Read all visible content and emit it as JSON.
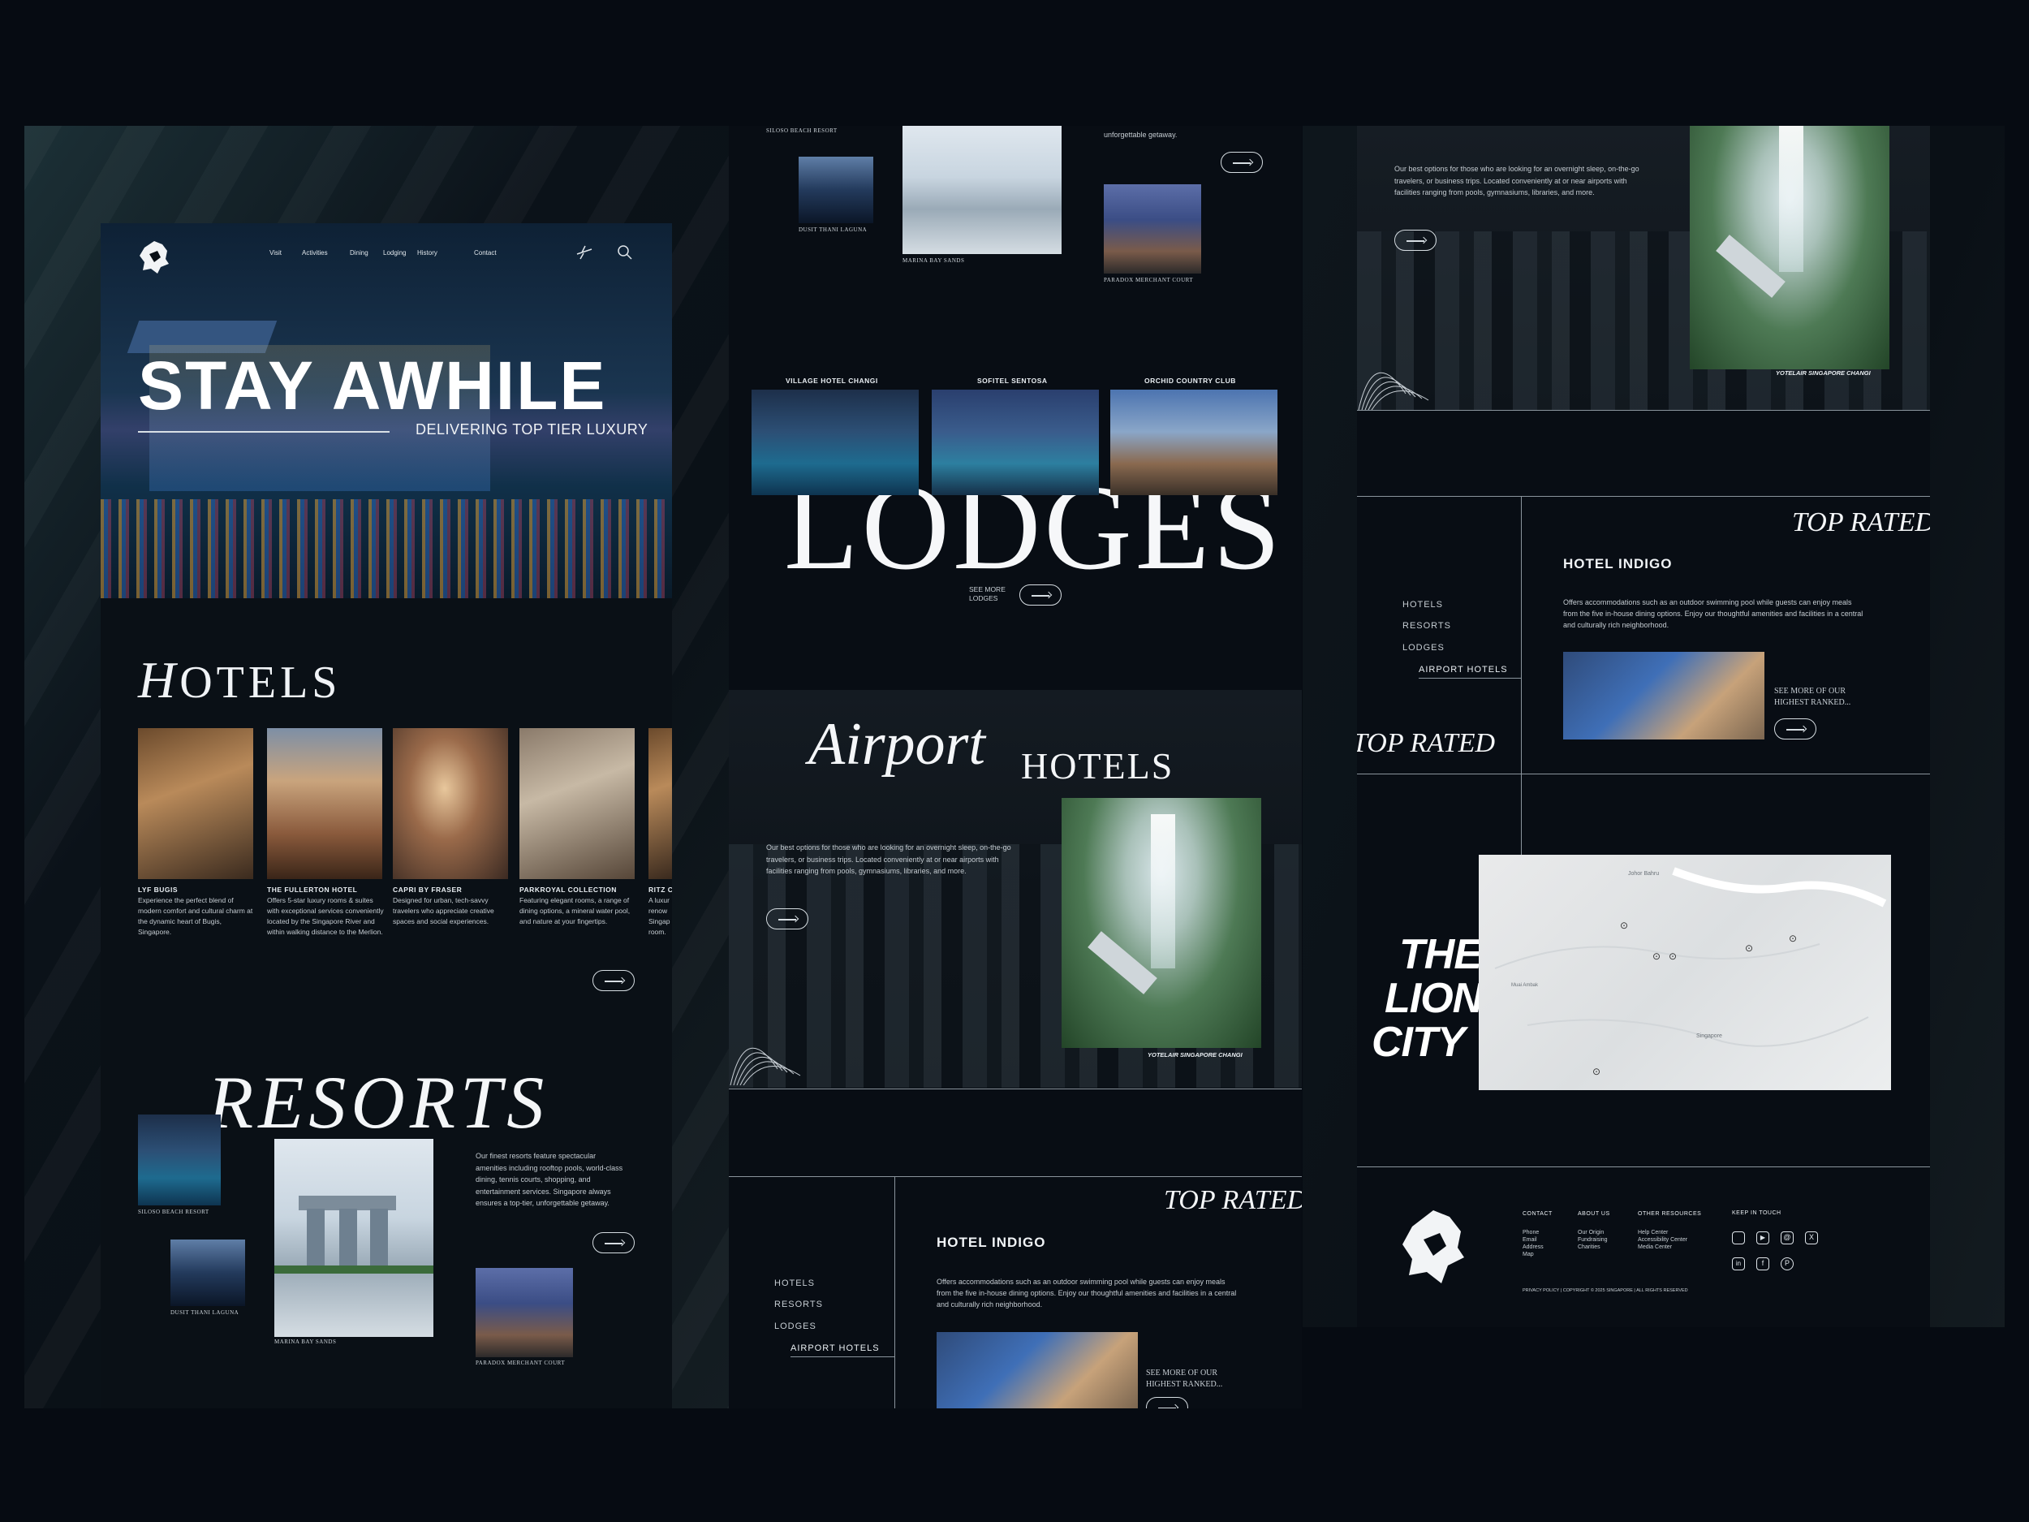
{
  "nav": {
    "items": [
      "Visit",
      "Activities",
      "Dining",
      "Lodging",
      "History",
      "Contact"
    ]
  },
  "hero": {
    "title": "STAY AWHILE",
    "subtitle": "DELIVERING TOP TIER LUXURY"
  },
  "hotels": {
    "heading_initial": "H",
    "heading_rest": "OTELS",
    "cards": [
      {
        "name": "LYF BUGIS",
        "desc": "Experience the perfect blend of modern comfort and cultural charm at the dynamic heart of Bugis, Singapore."
      },
      {
        "name": "THE FULLERTON HOTEL",
        "desc": "Offers 5-star luxury rooms & suites with exceptional services conveniently located by the Singapore River and within walking distance to the Merlion."
      },
      {
        "name": "CAPRI BY FRASER",
        "desc": "Designed for urban, tech-savvy travelers who appreciate creative spaces and social experiences."
      },
      {
        "name": "PARKROYAL COLLECTION",
        "desc": "Featuring elegant rooms, a range of dining options, a mineral water pool, and nature at your fingertips."
      },
      {
        "name": "RITZ C",
        "desc": "A luxur renow Singap room."
      }
    ]
  },
  "resorts": {
    "heading": "RESORTS",
    "desc": "Our finest resorts feature spectacular amenities including rooftop pools, world-class dining, tennis courts, shopping, and entertainment services. Singapore always ensures a top-tier, unforgettable getaway.",
    "captions": [
      "SILOSO BEACH RESORT",
      "DUSIT THANI LAGUNA",
      "MARINA BAY SANDS",
      "PARADOX MERCHANT COURT"
    ]
  },
  "middle": {
    "top_captions": [
      "SILOSO BEACH RESORT",
      "DUSIT THANI LAGUNA",
      "MARINA BAY SANDS",
      "PARADOX MERCHANT COURT"
    ],
    "top_text": "unforgettable getaway.",
    "lodges_captions": [
      "VILLAGE HOTEL CHANGI",
      "SOFITEL SENTOSA",
      "ORCHID COUNTRY CLUB"
    ],
    "lodges_heading": "LODGES",
    "see_more_1": "SEE MORE",
    "see_more_2": "LODGES",
    "airport_script": "Airport",
    "airport_rest": "HOTELS",
    "airport_desc": "Our best options for those who are looking for an overnight sleep, on-the-go travelers, or business trips. Located conveniently at or near airports with facilities ranging from pools, gymnasiums, libraries, and more.",
    "airport_caption": "YOTELAIR SINGAPORE CHANGI"
  },
  "top_rated": {
    "heading": "TOP RATED",
    "hotel": "HOTEL INDIGO",
    "desc": "Offers accommodations such as an outdoor swimming pool while guests can enjoy meals from the five in-house dining options. Enjoy our thoughtful amenities and facilities in a central and culturally rich neighborhood.",
    "menu": [
      "HOTELS",
      "RESORTS",
      "LODGES",
      "AIRPORT HOTELS"
    ],
    "see_more_1": "SEE MORE OF OUR",
    "see_more_2": "HIGHEST RANKED...",
    "left_heading": "TOP RATED"
  },
  "right": {
    "airport_desc": "Our best options for those who are looking for an overnight sleep, on-the-go travelers, or business trips. Located conveniently at or near airports with facilities ranging from pools, gymnasiums, libraries, and more.",
    "airport_caption": "YOTELAIR SINGAPORE CHANGI",
    "lion_city": [
      "THE",
      "LION",
      "CITY"
    ],
    "map_labels": [
      "Johor Bahru",
      "Singapore",
      "Muai Ambak"
    ]
  },
  "footer": {
    "contact": {
      "title": "CONTACT",
      "items": [
        "Phone",
        "Email",
        "Address",
        "Map"
      ]
    },
    "about": {
      "title": "ABOUT US",
      "items": [
        "Our Origin",
        "Fundraising",
        "Charities"
      ]
    },
    "resources": {
      "title": "OTHER RESOURCES",
      "items": [
        "Help Center",
        "Accessibility Center",
        "Media Center"
      ]
    },
    "keep": {
      "title": "KEEP IN TOUCH"
    },
    "legal": "PRIVACY POLICY | COPYRIGHT © 2025 SINGAPORE | ALL RIGHTS RESERVED"
  },
  "colors": {
    "background": "#060b12",
    "panel": "#0a1117",
    "text": "#e9eef2",
    "line": "#8a949c"
  }
}
